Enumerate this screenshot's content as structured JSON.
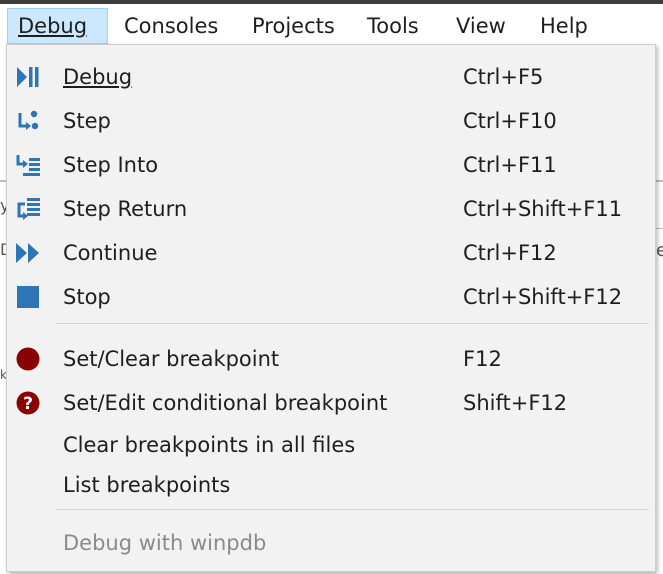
{
  "menubar": {
    "items": [
      {
        "label": "Debug",
        "active": true
      },
      {
        "label": "Consoles"
      },
      {
        "label": "Projects"
      },
      {
        "label": "Tools"
      },
      {
        "label": "View"
      },
      {
        "label": "Help"
      }
    ]
  },
  "colors": {
    "icon_blue": "#2e75b6",
    "breakpoint_red": "#8b0000",
    "highlight": "#cce8ff",
    "disabled_text": "#8a8a8a"
  },
  "menu": {
    "items": [
      {
        "label": "Debug",
        "shortcut": "Ctrl+F5",
        "icon": "debug-play-pause-icon"
      },
      {
        "label": "Step",
        "shortcut": "Ctrl+F10",
        "icon": "step-icon"
      },
      {
        "label": "Step Into",
        "shortcut": "Ctrl+F11",
        "icon": "step-into-icon"
      },
      {
        "label": "Step Return",
        "shortcut": "Ctrl+Shift+F11",
        "icon": "step-return-icon"
      },
      {
        "label": "Continue",
        "shortcut": "Ctrl+F12",
        "icon": "continue-icon"
      },
      {
        "label": "Stop",
        "shortcut": "Ctrl+Shift+F12",
        "icon": "stop-icon"
      },
      {
        "label": "Set/Clear breakpoint",
        "shortcut": "F12",
        "icon": "breakpoint-icon"
      },
      {
        "label": "Set/Edit conditional breakpoint",
        "shortcut": "Shift+F12",
        "icon": "conditional-breakpoint-icon"
      },
      {
        "label": "Clear breakpoints in all files",
        "shortcut": ""
      },
      {
        "label": "List breakpoints",
        "shortcut": ""
      },
      {
        "label": "Debug with winpdb",
        "shortcut": "",
        "disabled": true
      }
    ]
  },
  "background": {
    "right_fragment": "e",
    "left_fragments": [
      "y",
      "D",
      "k"
    ]
  }
}
